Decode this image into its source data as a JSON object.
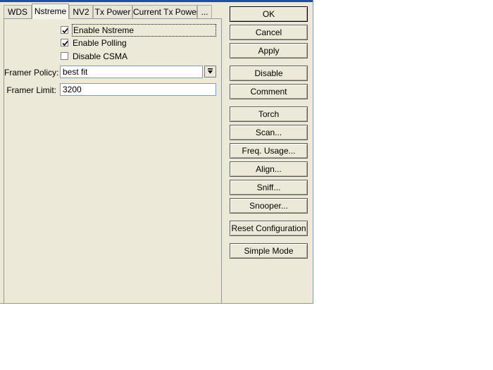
{
  "tabs": [
    {
      "label": "WDS"
    },
    {
      "label": "Nstreme"
    },
    {
      "label": "NV2"
    },
    {
      "label": "Tx Power"
    },
    {
      "label": "Current Tx Power"
    },
    {
      "label": "..."
    }
  ],
  "nstreme": {
    "enable_nstreme": {
      "label": "Enable Nstreme",
      "checked": true
    },
    "enable_polling": {
      "label": "Enable Polling",
      "checked": true
    },
    "disable_csma": {
      "label": "Disable CSMA",
      "checked": false
    },
    "framer_policy": {
      "label": "Framer Policy:",
      "value": "best fit"
    },
    "framer_limit": {
      "label": "Framer Limit:",
      "value": "3200"
    }
  },
  "buttons": {
    "ok": "OK",
    "cancel": "Cancel",
    "apply": "Apply",
    "disable": "Disable",
    "comment": "Comment",
    "torch": "Torch",
    "scan": "Scan...",
    "freq_usage": "Freq. Usage...",
    "align": "Align...",
    "sniff": "Sniff...",
    "snooper": "Snooper...",
    "reset_configuration": "Reset Configuration",
    "simple_mode": "Simple Mode"
  },
  "colors": {
    "title_strip": "#1f4fa3",
    "window_bg": "#ece9d8"
  }
}
